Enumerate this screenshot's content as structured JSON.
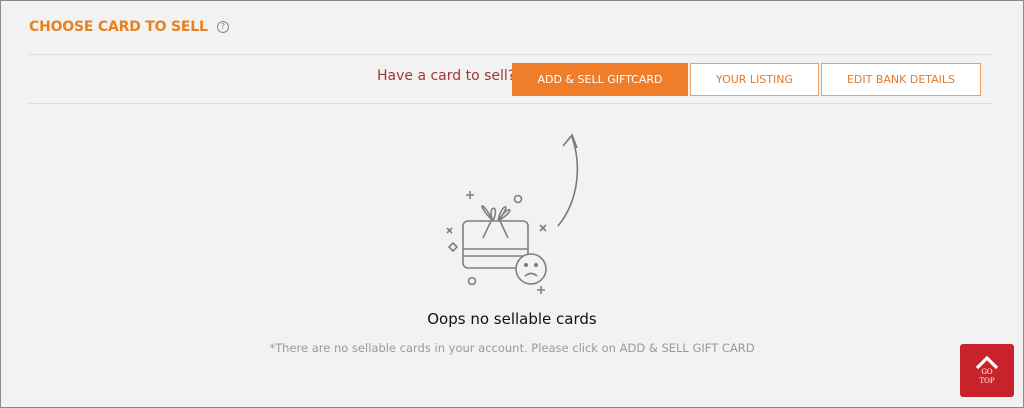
{
  "header": {
    "title": "CHOOSE CARD TO SELL",
    "help_icon": "question-circle-icon"
  },
  "toolbar": {
    "prompt": "Have a card to sell?",
    "add_sell_label": "ADD & SELL GIFTCARD",
    "your_listing_label": "YOUR LISTING",
    "edit_bank_label": "EDIT BANK DETAILS"
  },
  "empty_state": {
    "icon": "gift-card-sad-face-icon",
    "title": "Oops no sellable cards",
    "note": "*There are no sellable cards in your account. Please click on ADD & SELL GIFT CARD"
  },
  "go_top": {
    "line1": "GO",
    "line2": "TOP",
    "icon": "chevron-up-icon"
  },
  "colors": {
    "accent": "#f07d2a",
    "title": "#e8821f",
    "prompt": "#a33636",
    "go_top_bg": "#c8222c"
  }
}
